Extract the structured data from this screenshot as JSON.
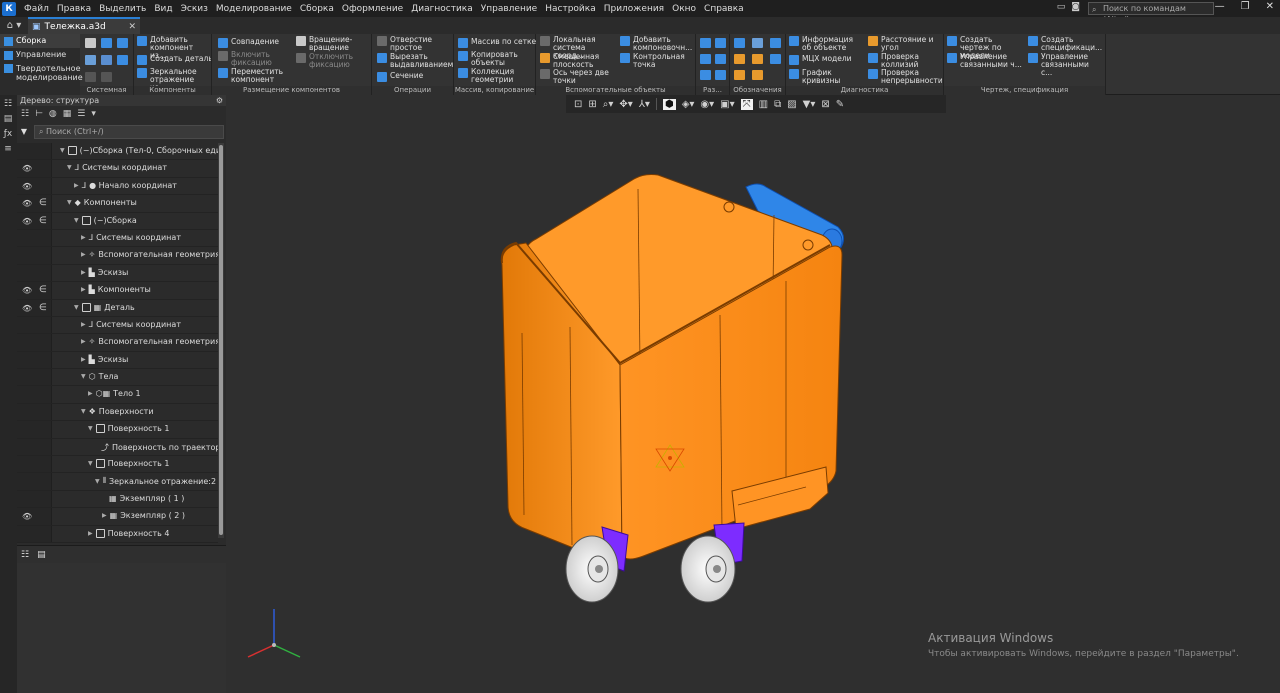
{
  "menubar": {
    "items": [
      "Файл",
      "Правка",
      "Выделить",
      "Вид",
      "Эскиз",
      "Моделирование",
      "Сборка",
      "Оформление",
      "Диагностика",
      "Управление",
      "Настройка",
      "Приложения",
      "Окно",
      "Справка"
    ],
    "search_placeholder": "Поиск по командам (Alt+/)"
  },
  "tabbar": {
    "doc_tab": "Тележка.a3d"
  },
  "ribbon": {
    "left_items": [
      "Сборка",
      "Управление",
      "Твердотельное моделирование"
    ],
    "groups": [
      "Системная",
      "Компоненты",
      "Размещение компонентов",
      "Операции",
      "Массив, копирование",
      "Вспомогательные объекты",
      "Раз...",
      "Обозначения",
      "Диагностика",
      "Чертеж, спецификация"
    ],
    "buttons": {
      "add_component": "Добавить компонент из...",
      "create_part": "Создать деталь",
      "mirror_component": "Зеркальное отражение ко...",
      "coincidence": "Совпадение",
      "enable_fix": "Включить фиксацию",
      "move_component": "Переместить компонент",
      "rotation": "Вращение-вращение",
      "disable_fix": "Отключить фиксацию",
      "simple_hole": "Отверстие простое",
      "cut_extrude": "Вырезать выдавливанием",
      "section": "Сечение",
      "grid_array": "Массив по сетке",
      "copy_objects": "Копировать объекты",
      "geometry_collection": "Коллекция геометрии",
      "local_cs": "Локальная система коорд...",
      "offset_plane": "Смещенная плоскость",
      "axis_two_points": "Ось через две точки",
      "add_layout": "Добавить компоновочн...",
      "control_point": "Контрольная точка",
      "object_info": "Информация об объекте",
      "mass_props": "МЦХ модели",
      "curvature_plot": "График кривизны",
      "distance_angle": "Расстояние и угол",
      "check_collisions": "Проверка коллизий",
      "check_continuity": "Проверка непрерывности",
      "create_drawing": "Создать чертеж по модели",
      "manage_linked_drawings": "Управление связанными ч...",
      "create_spec": "Создать спецификаци...",
      "manage_linked_specs": "Управление связанными с..."
    }
  },
  "tree": {
    "header": "Дерево: структура",
    "search_placeholder": "Поиск (Ctrl+/)",
    "rows": [
      {
        "label": "(−)Сборка (Тел-0, Сборочных единиц",
        "eye": "",
        "inc": ""
      },
      {
        "label": "Системы координат",
        "eye": "👁",
        "inc": ""
      },
      {
        "label": "● Начало координат",
        "eye": "👁",
        "inc": ""
      },
      {
        "label": "Компоненты",
        "eye": "👁",
        "inc": "∈"
      },
      {
        "label": "(−)Сборка",
        "eye": "👁",
        "inc": "∈"
      },
      {
        "label": "Системы координат",
        "eye": "",
        "inc": ""
      },
      {
        "label": "Вспомогательная геометрия",
        "eye": "",
        "inc": ""
      },
      {
        "label": "Эскизы",
        "eye": "",
        "inc": ""
      },
      {
        "label": "Компоненты",
        "eye": "👁",
        "inc": "∈"
      },
      {
        "label": "Деталь",
        "eye": "👁",
        "inc": "∈"
      },
      {
        "label": "Системы координат",
        "eye": "",
        "inc": ""
      },
      {
        "label": "Вспомогательная геометрия",
        "eye": "",
        "inc": ""
      },
      {
        "label": "Эскизы",
        "eye": "",
        "inc": ""
      },
      {
        "label": "Тела",
        "eye": "",
        "inc": ""
      },
      {
        "label": "Тело 1",
        "eye": "",
        "inc": ""
      },
      {
        "label": "Поверхности",
        "eye": "",
        "inc": ""
      },
      {
        "label": "Поверхность 1",
        "eye": "",
        "inc": ""
      },
      {
        "label": "Поверхность по траектории",
        "eye": "",
        "inc": ""
      },
      {
        "label": "Поверхность 1",
        "eye": "",
        "inc": ""
      },
      {
        "label": "Зеркальное отражение:2",
        "eye": "",
        "inc": ""
      },
      {
        "label": "Экземпляр ( 1 )",
        "eye": "",
        "inc": ""
      },
      {
        "label": "Экземпляр ( 2 )",
        "eye": "👁",
        "inc": ""
      },
      {
        "label": "Поверхность 4",
        "eye": "",
        "inc": ""
      }
    ]
  },
  "watermark": {
    "title": "Активация Windows",
    "subtitle": "Чтобы активировать Windows, перейдите в раздел \"Параметры\"."
  },
  "colors": {
    "accent": "#2a7fd4",
    "bin": "#ff8a12",
    "handle": "#2f86e8",
    "bracket": "#7d2cff"
  }
}
